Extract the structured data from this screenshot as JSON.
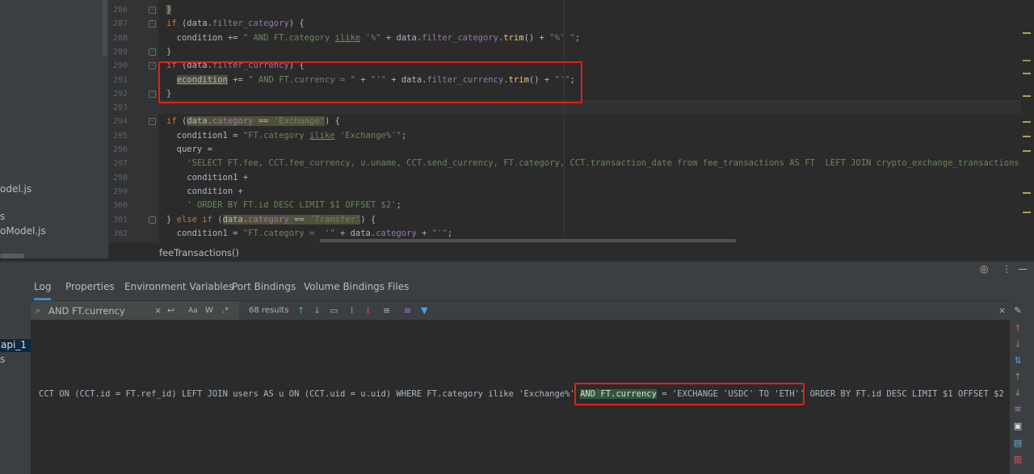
{
  "sidebar": {
    "items": [
      "odel.js",
      "s",
      "oModel.js"
    ]
  },
  "editor": {
    "lines": [
      {
        "n": "286",
        "html": "<span class='hlw'>}</span>"
      },
      {
        "n": "287",
        "html": "<span class='kw'>if</span> (data.<span class='prop'>filter_category</span>) {"
      },
      {
        "n": "288",
        "html": "  condition += <span class='str'>\" AND FT.category <span class='under'>ilike</span> '%\"</span> + data.<span class='prop'>filter_category</span>.<span class='fn'>trim</span>() + <span class='str'>\"%' \"</span>;"
      },
      {
        "n": "289",
        "html": "}"
      },
      {
        "n": "290",
        "html": "<span class='kw'>if</span> (data.<span class='prop'>filter_currency</span>) {"
      },
      {
        "n": "291",
        "html": "  <span class='hlw under'>econdition</span> += <span class='str'>\" AND FT.currency = \"</span> + <span class='str'>\"'\"</span> + data.<span class='prop'>filter_currency</span>.<span class='fn'>trim</span>() + <span class='str'>\"'\"</span>;"
      },
      {
        "n": "292",
        "html": "}"
      },
      {
        "n": "293",
        "html": ""
      },
      {
        "n": "294",
        "html": "<span class='kw'>if</span> (<span class='hlw'>data.<span class='prop'>category</span> == <span class='str'>'Exchange'</span></span>) {"
      },
      {
        "n": "295",
        "html": "  condition1 = <span class='str'>\"FT.category <span class='under'>ilike</span> 'Exchange%'\"</span>;"
      },
      {
        "n": "296",
        "html": "  query ="
      },
      {
        "n": "297",
        "html": "    <span class='str'>'SELECT FT.fee, CCT.fee_currency, u.uname, CCT.send_currency, FT.category, CCT.transaction_date from fee_transactions AS FT  LEFT JOIN crypto_exchange_transactions AS</span>"
      },
      {
        "n": "298",
        "html": "    condition1 +"
      },
      {
        "n": "299",
        "html": "    condition +"
      },
      {
        "n": "300",
        "html": "    <span class='str'>' ORDER BY FT.id DESC LIMIT $1 OFFSET $2'</span>;"
      },
      {
        "n": "301",
        "html": "} <span class='kw'>else if</span> (<span class='hlw'>data.<span class='prop'>category</span> == <span class='str'>'Transfer'</span></span>) {"
      },
      {
        "n": "302",
        "html": "  condition1 = <span class='str'>\"FT.category =  '\"</span> + data.<span class='prop'>category</span> + <span class='str'>\"'\"</span>;"
      }
    ]
  },
  "breadcrumb": "feeTransactions()",
  "panel_left": {
    "items": [
      "api_1",
      "s"
    ]
  },
  "tabs": [
    "Log",
    "Properties",
    "Environment Variables",
    "Port Bindings",
    "Volume Bindings",
    "Files"
  ],
  "find": {
    "value": "AND FT.currency",
    "results": "68 results",
    "match_case": "Aa",
    "words": "W",
    "regex": ".*"
  },
  "log": {
    "before": "CCT ON (CCT.id = FT.ref_id) LEFT JOIN users AS u ON (CCT.uid = u.uid) WHERE FT.category ilike 'Exchange%' ",
    "match": "AND FT.currency",
    "after": " = 'EXCHANGE 'USDC' TO 'ETH'' ORDER BY FT.id DESC LIMIT $1 OFFSET $2 -"
  }
}
